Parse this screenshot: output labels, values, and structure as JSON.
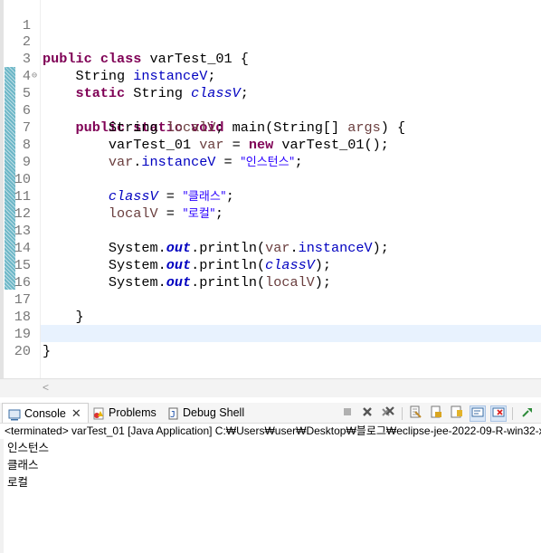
{
  "editor": {
    "lines": [
      {
        "n": "1"
      },
      {
        "n": "2"
      },
      {
        "n": "3"
      },
      {
        "n": "4"
      },
      {
        "n": "5"
      },
      {
        "n": "6"
      },
      {
        "n": "7"
      },
      {
        "n": "8"
      },
      {
        "n": "9"
      },
      {
        "n": "10"
      },
      {
        "n": "11"
      },
      {
        "n": "12"
      },
      {
        "n": "13"
      },
      {
        "n": "14"
      },
      {
        "n": "15"
      },
      {
        "n": "16"
      },
      {
        "n": "17"
      },
      {
        "n": "18"
      },
      {
        "n": "19"
      },
      {
        "n": "20"
      }
    ],
    "fold_marker": "⊖",
    "code": {
      "l2": {
        "kw1": "public",
        "kw2": "class",
        "name": "varTest_01 {"
      },
      "l3": {
        "type": "String ",
        "field": "instanceV",
        "end": ";"
      },
      "l4": {
        "kw": "static",
        "type": " String ",
        "field": "classV",
        "end": ";"
      },
      "l5": {
        "kw1": "public",
        "kw2": "static",
        "kw3": "void",
        "sig": " main(String[] ",
        "arg": "args",
        "end": ") {"
      },
      "l6": {
        "type": "String ",
        "var": "localV",
        "end": ";"
      },
      "l7": {
        "type": "varTest_01 ",
        "var": "var",
        "mid": " = ",
        "kw": "new",
        "end": " varTest_01();"
      },
      "l8": {
        "var": "var",
        "dot": ".",
        "field": "instanceV",
        "mid": " = ",
        "str": "\"인스턴스\"",
        "end": ";"
      },
      "l10": {
        "field": "classV",
        "mid": " = ",
        "str": "\"클래스\"",
        "end": ";"
      },
      "l11": {
        "var": "localV",
        "mid": " = ",
        "str": "\"로컬\"",
        "end": ";"
      },
      "l13": {
        "sys": "System.",
        "out": "out",
        "call": ".println(",
        "var": "var",
        "dot": ".",
        "field": "instanceV",
        "end": ");"
      },
      "l14": {
        "sys": "System.",
        "out": "out",
        "call": ".println(",
        "field": "classV",
        "end": ");"
      },
      "l15": {
        "sys": "System.",
        "out": "out",
        "call": ".println(",
        "var": "localV",
        "end": ");"
      },
      "l17": {
        "end": "}"
      },
      "l19": {
        "end": "}"
      }
    }
  },
  "hscroll": {
    "left_arrow": "<"
  },
  "console": {
    "tabs": {
      "console": "Console",
      "problems": "Problems",
      "debug": "Debug Shell",
      "close": "✕"
    },
    "status": "<terminated> varTest_01 [Java Application] C:₩Users₩user₩Desktop₩블로그₩eclipse-jee-2022-09-R-win32-x86_64",
    "output": [
      "인스턴스",
      "클래스",
      "로컬"
    ]
  },
  "colors": {
    "keyword": "#7f0055",
    "field": "#0000c0",
    "string": "#2a00ff",
    "local": "#6a3e3e",
    "current_line": "#e8f2fe"
  }
}
